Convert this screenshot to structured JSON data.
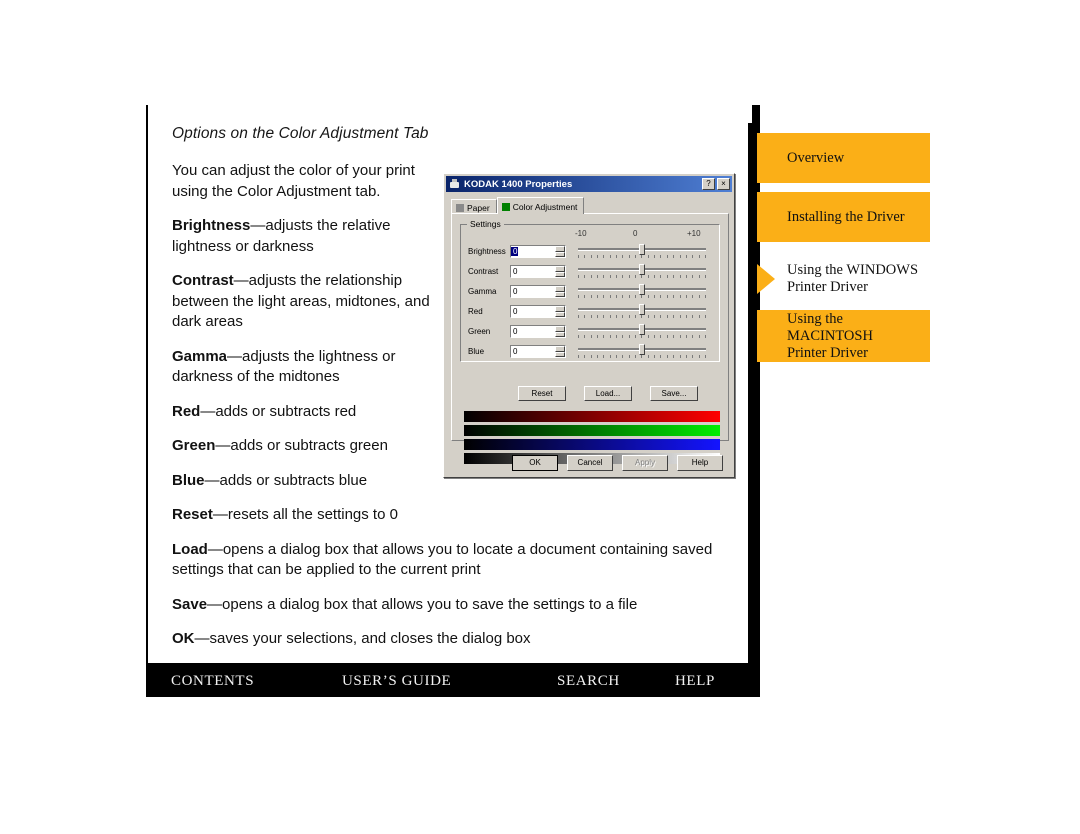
{
  "document": {
    "section_title": "Options on the Color Adjustment Tab",
    "paragraphs": [
      {
        "lead": "",
        "text": "You can adjust the color of your print using the Color Adjustment tab.",
        "wide": false
      },
      {
        "lead": "Brightness",
        "text": "—adjusts the relative lightness or darkness",
        "wide": false
      },
      {
        "lead": "Contrast",
        "text": "—adjusts the relationship between the light areas, midtones, and dark areas",
        "wide": false
      },
      {
        "lead": "Gamma",
        "text": "—adjusts the lightness or darkness of the midtones",
        "wide": false
      },
      {
        "lead": "Red",
        "text": "—adds or subtracts red",
        "wide": false
      },
      {
        "lead": "Green",
        "text": "—adds or subtracts green",
        "wide": false
      },
      {
        "lead": "Blue",
        "text": "—adds or subtracts blue",
        "wide": false
      },
      {
        "lead": "Reset",
        "text": "—resets all the settings to 0",
        "wide": false
      },
      {
        "lead": "Load",
        "text": "—opens a dialog box that allows you to locate a document containing saved settings that can be applied to the current print",
        "wide": true
      },
      {
        "lead": "Save",
        "text": "—opens a dialog box that allows you to save the settings to a file",
        "wide": true
      },
      {
        "lead": "OK",
        "text": "—saves your selections, and closes the dialog box",
        "wide": true
      }
    ]
  },
  "sidebar": {
    "accent_color": "#FBAF17",
    "items": [
      {
        "label": "Overview",
        "lines": [
          "Overview"
        ],
        "current": false
      },
      {
        "label": "Installing the Driver",
        "lines": [
          "Installing the Driver"
        ],
        "current": false
      },
      {
        "label": "Using the WINDOWS Printer Driver",
        "lines": [
          "Using the WINDOWS",
          "Printer Driver"
        ],
        "current": true
      },
      {
        "label": "Using the MACINTOSH Printer Driver",
        "lines": [
          "Using the",
          "MACINTOSH",
          "Printer Driver"
        ],
        "current": false
      }
    ]
  },
  "bottom_bar": {
    "contents": "CONTENTS",
    "users_guide": "USER’S GUIDE",
    "search": "SEARCH",
    "help": "HELP"
  },
  "dialog": {
    "title": "KODAK 1400 Properties",
    "titlebar_buttons": [
      "?",
      "×"
    ],
    "tabs": [
      {
        "label": "Paper",
        "icon": "paper-icon",
        "active": false
      },
      {
        "label": "Color Adjustment",
        "icon": "color-adjustment-icon",
        "active": true
      }
    ],
    "group_label": "Settings",
    "scale": {
      "min": "-10",
      "mid": "0",
      "max": "+10"
    },
    "sliders": [
      {
        "label": "Brightness",
        "value": "0"
      },
      {
        "label": "Contrast",
        "value": "0"
      },
      {
        "label": "Gamma",
        "value": "0"
      },
      {
        "label": "Red",
        "value": "0"
      },
      {
        "label": "Green",
        "value": "0"
      },
      {
        "label": "Blue",
        "value": "0"
      }
    ],
    "settings_buttons": [
      {
        "label": "Reset",
        "disabled": false
      },
      {
        "label": "Load...",
        "disabled": false
      },
      {
        "label": "Save...",
        "disabled": false
      }
    ],
    "preview_bars": [
      "red",
      "green",
      "blue",
      "gray"
    ],
    "footer_buttons": [
      {
        "label": "OK",
        "disabled": false,
        "default": true
      },
      {
        "label": "Cancel",
        "disabled": false,
        "default": false
      },
      {
        "label": "Apply",
        "disabled": true,
        "default": false
      },
      {
        "label": "Help",
        "disabled": false,
        "default": false
      }
    ]
  }
}
